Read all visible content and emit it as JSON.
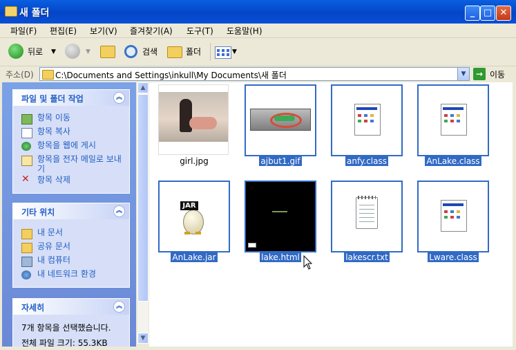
{
  "window": {
    "title": "새 폴더"
  },
  "menu": [
    "파일(F)",
    "편집(E)",
    "보기(V)",
    "즐겨찾기(A)",
    "도구(T)",
    "도움말(H)"
  ],
  "toolbar": {
    "back_label": "뒤로",
    "search_label": "검색",
    "folders_label": "폴더"
  },
  "address": {
    "label": "주소(D)",
    "value": "C:\\Documents and Settings\\inkull\\My Documents\\새 폴더",
    "go_label": "이동"
  },
  "panels": {
    "tasks": {
      "title": "파일 및 폴더 작업",
      "items": [
        "항목 이동",
        "항목 복사",
        "항목을 웹에 게시",
        "항목을 전자 메일로 보내기",
        "항목 삭제"
      ]
    },
    "places": {
      "title": "기타 위치",
      "items": [
        "내 문서",
        "공유 문서",
        "내 컴퓨터",
        "내 네트워크 환경"
      ]
    },
    "details": {
      "title": "자세히",
      "selected_text": "7개 항목을 선택했습니다.",
      "total_size": "전체 파일 크기: 55.3KB"
    }
  },
  "files": [
    {
      "name": "girl.jpg",
      "selected": false,
      "icon": "jpg-thumbnail"
    },
    {
      "name": "ajbut1.gif",
      "selected": true,
      "icon": "gif-thumbnail"
    },
    {
      "name": "anfy.class",
      "selected": true,
      "icon": "class-file-icon"
    },
    {
      "name": "AnLake.class",
      "selected": true,
      "icon": "class-file-icon"
    },
    {
      "name": "AnLake.jar",
      "selected": true,
      "icon": "jar-file-icon"
    },
    {
      "name": "lake.html",
      "selected": true,
      "icon": "html-thumbnail"
    },
    {
      "name": "lakescr.txt",
      "selected": true,
      "icon": "text-file-icon"
    },
    {
      "name": "Lware.class",
      "selected": true,
      "icon": "class-file-icon"
    }
  ],
  "icons": {
    "jar_badge": "JAR"
  },
  "colors": {
    "selection": "#316ac5",
    "title_bar": "#0a4ed6",
    "task_link": "#215dc6"
  }
}
